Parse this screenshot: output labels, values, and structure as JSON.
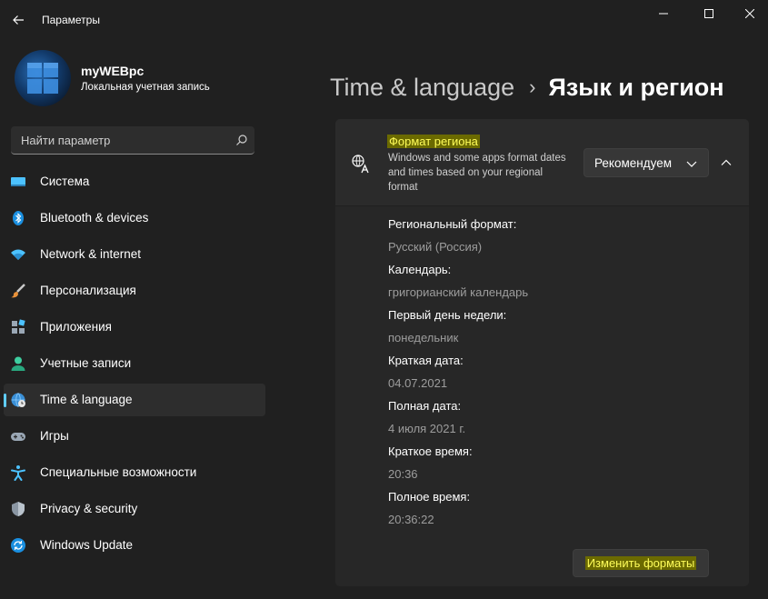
{
  "window": {
    "title": "Параметры"
  },
  "profile": {
    "name": "myWEBpc",
    "account_type": "Локальная учетная запись"
  },
  "search": {
    "placeholder": "Найти параметр"
  },
  "sidebar": {
    "items": [
      {
        "label": "Система",
        "icon": "system-icon",
        "active": false
      },
      {
        "label": "Bluetooth & devices",
        "icon": "bluetooth-icon",
        "active": false
      },
      {
        "label": "Network & internet",
        "icon": "wifi-icon",
        "active": false
      },
      {
        "label": "Персонализация",
        "icon": "brush-icon",
        "active": false
      },
      {
        "label": "Приложения",
        "icon": "apps-icon",
        "active": false
      },
      {
        "label": "Учетные записи",
        "icon": "accounts-icon",
        "active": false
      },
      {
        "label": "Time & language",
        "icon": "globe-clock-icon",
        "active": true
      },
      {
        "label": "Игры",
        "icon": "gamepad-icon",
        "active": false
      },
      {
        "label": "Специальные возможности",
        "icon": "accessibility-icon",
        "active": false
      },
      {
        "label": "Privacy & security",
        "icon": "shield-icon",
        "active": false
      },
      {
        "label": "Windows Update",
        "icon": "update-icon",
        "active": false
      }
    ]
  },
  "header": {
    "parent": "Time & language",
    "current": "Язык и регион"
  },
  "region_card": {
    "title": "Формат региона",
    "description": "Windows and some apps format dates and times based on your regional format",
    "dropdown_value": "Рекомендуем",
    "fields": [
      {
        "label": "Региональный формат:",
        "value": "Русский (Россия)"
      },
      {
        "label": "Календарь:",
        "value": "григорианский календарь"
      },
      {
        "label": "Первый день недели:",
        "value": "понедельник"
      },
      {
        "label": "Краткая дата:",
        "value": "04.07.2021"
      },
      {
        "label": "Полная дата:",
        "value": "4 июля 2021 г."
      },
      {
        "label": "Краткое время:",
        "value": "20:36"
      },
      {
        "label": "Полное время:",
        "value": "20:36:22"
      }
    ],
    "change_button": "Изменить форматы"
  },
  "colors": {
    "background": "#202020",
    "accent": "#60cdff",
    "highlight_text": "#fffd5a"
  }
}
